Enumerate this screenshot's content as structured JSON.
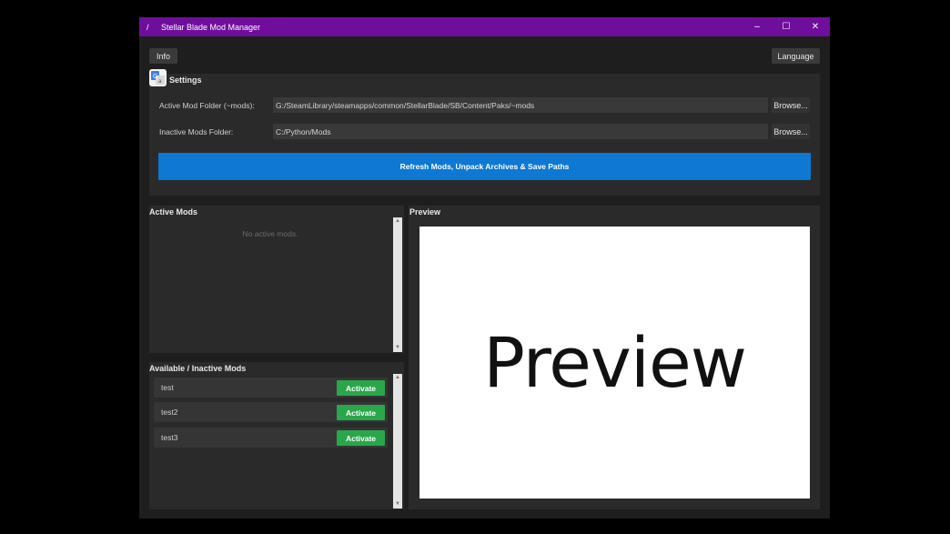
{
  "window": {
    "title": "Stellar Blade Mod Manager",
    "app_icon": "/",
    "controls": {
      "minimize": "–",
      "maximize": "☐",
      "close": "✕"
    },
    "accent_color": "#6f0e9c"
  },
  "toolbar": {
    "info_label": "Info",
    "language_label": "Language"
  },
  "settings": {
    "title": "Settings",
    "active_label": "Active Mod Folder (~mods):",
    "active_path": "G:/SteamLibrary/steamapps/common/StellarBlade/SB/Content/Paks/~mods",
    "inactive_label": "Inactive Mods Folder:",
    "inactive_path": "C:/Python/Mods",
    "browse_label": "Browse...",
    "refresh_label": "Refresh Mods, Unpack Archives & Save Paths",
    "refresh_color": "#0e78d2"
  },
  "active_mods": {
    "title": "Active Mods",
    "empty_text": "No active mods."
  },
  "inactive_mods": {
    "title": "Available / Inactive Mods",
    "items": [
      {
        "name": "test",
        "action": "Activate"
      },
      {
        "name": "test2",
        "action": "Activate"
      },
      {
        "name": "test3",
        "action": "Activate"
      }
    ],
    "action_color": "#2aa64b"
  },
  "preview": {
    "title": "Preview",
    "placeholder": "Preview"
  }
}
